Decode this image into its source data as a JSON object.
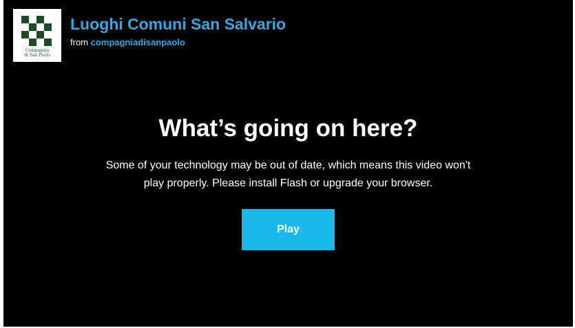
{
  "header": {
    "logo": {
      "icon": "compagnia-di-san-paolo-logo",
      "caption": [
        "Compagnia",
        "di San Paolo"
      ],
      "color": "#1e4a2a"
    },
    "title": "Luoghi Comuni San Salvario",
    "byline_prefix": "from",
    "owner": "compagniadisanpaolo"
  },
  "message": {
    "heading": "What’s going on here?",
    "body": [
      "Some of your technology may be out of date, which means this video won't",
      "play properly. Please install Flash or upgrade your browser."
    ]
  },
  "play_button": {
    "label": "Play",
    "color": "#1ab7ea"
  },
  "colors": {
    "background": "#000000",
    "link": "#3aa6e0",
    "text": "#ffffff"
  }
}
